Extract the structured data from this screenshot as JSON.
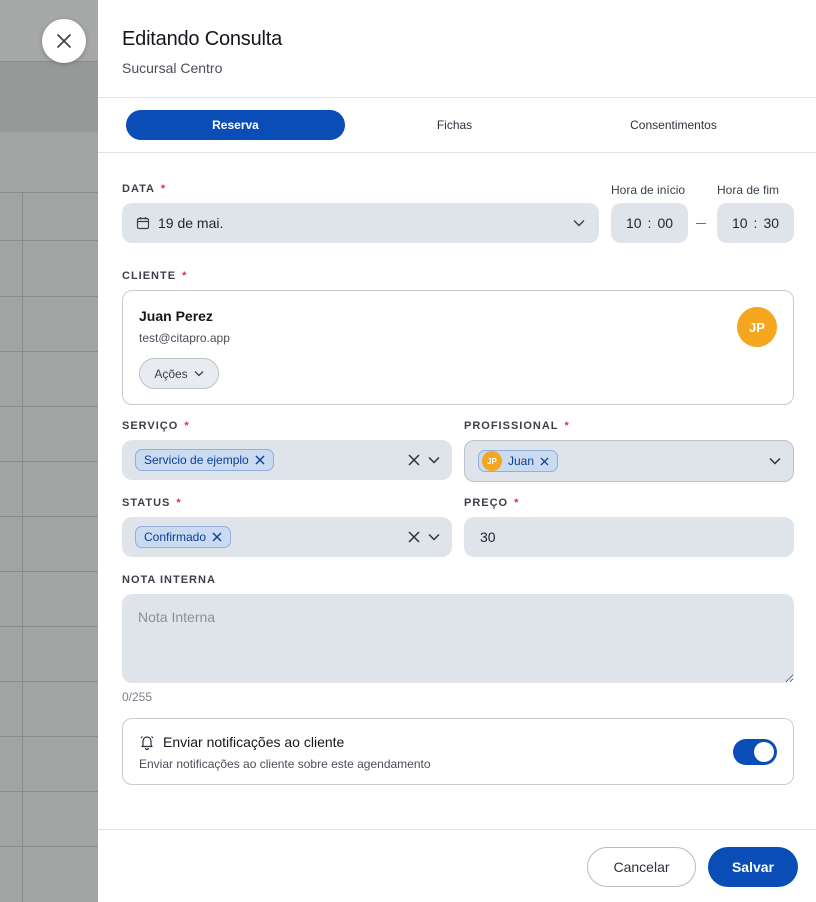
{
  "panel": {
    "title": "Editando Consulta",
    "subtitle": "Sucursal Centro"
  },
  "tabs": [
    {
      "label": "Reserva",
      "active": true
    },
    {
      "label": "Fichas",
      "active": false
    },
    {
      "label": "Consentimentos",
      "active": false
    }
  ],
  "form": {
    "date": {
      "label": "DATA",
      "required": "*",
      "value": "19 de mai."
    },
    "start_time": {
      "label": "Hora de início",
      "hour": "10",
      "minute": "00",
      "separator": ":"
    },
    "end_time": {
      "label": "Hora de fim",
      "hour": "10",
      "minute": "30",
      "separator": ":"
    },
    "client": {
      "label": "CLIENTE",
      "required": "*",
      "name": "Juan Perez",
      "email": "test@citapro.app",
      "initials": "JP",
      "actions_label": "Ações"
    },
    "service": {
      "label": "SERVIÇO",
      "required": "*",
      "selected": "Servicio de ejemplo"
    },
    "professional": {
      "label": "PROFISSIONAL",
      "required": "*",
      "selected": "Juan",
      "initials": "JP"
    },
    "status": {
      "label": "STATUS",
      "required": "*",
      "selected": "Confirmado"
    },
    "price": {
      "label": "PREÇO",
      "required": "*",
      "value": "30"
    },
    "note": {
      "label": "NOTA INTERNA",
      "placeholder": "Nota Interna",
      "value": "",
      "counter": "0/255"
    },
    "notifications": {
      "title": "Enviar notificações ao cliente",
      "description": "Enviar notificações ao cliente sobre este agendamento",
      "enabled": true
    }
  },
  "footer": {
    "cancel_label": "Cancelar",
    "save_label": "Salvar"
  },
  "colors": {
    "primary": "#0b4db6",
    "avatar": "#f4a61e",
    "required": "#d9333f",
    "field_bg": "#dfe4ea"
  }
}
